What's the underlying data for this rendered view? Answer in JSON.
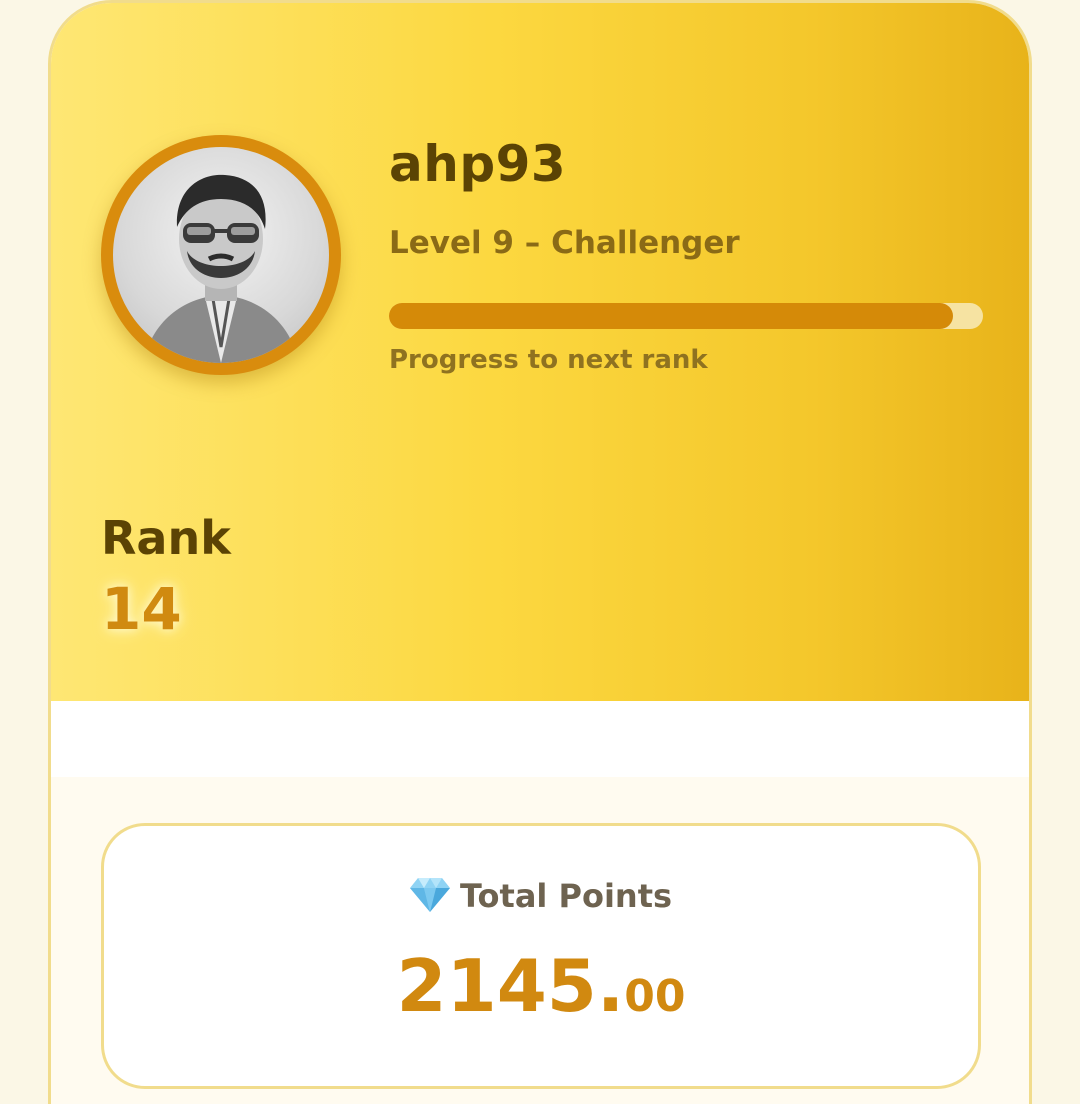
{
  "profile": {
    "username": "ahp93",
    "level_text": "Level 9 – Challenger",
    "progress_fraction": 0.95,
    "progress_label": "Progress to next rank",
    "avatar_icon": "user-avatar-photo"
  },
  "rank": {
    "label": "Rank",
    "value": "14"
  },
  "points": {
    "icon": "gem-icon",
    "title": "Total Points",
    "value_integer": "2145.",
    "value_decimal": "00"
  },
  "colors": {
    "accent": "#d58a08",
    "header_start": "#fee774",
    "header_end": "#e8b31a",
    "text_dark": "#5b4304"
  }
}
